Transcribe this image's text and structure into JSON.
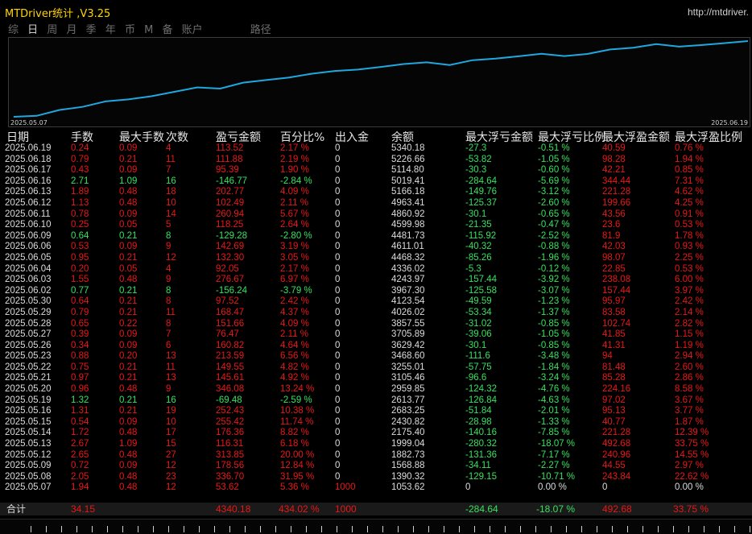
{
  "title": "MTDriver统计 ,V3.25",
  "url": "http://mtdriver.",
  "tabs": [
    "综",
    "日",
    "周",
    "月",
    "季",
    "年",
    "币",
    "M",
    "备",
    "账户"
  ],
  "tab_path": "路径",
  "active_tab": "日",
  "chart": {
    "x_start_label": "2025.05.07",
    "x_end_label": "2025.06.19",
    "line_color": "#1fa8e0"
  },
  "headers": [
    "日期",
    "手数",
    "最大手数",
    "次数",
    "盈亏金额",
    "百分比%",
    "出入金",
    "余额",
    "最大浮亏金额",
    "最大浮亏比例",
    "最大浮盈金额",
    "最大浮盈比例"
  ],
  "rows": [
    {
      "date": "2025.06.19",
      "lots": "0.24",
      "maxlots": "0.09",
      "count": "4",
      "pl": "113.52",
      "pct": "2.17 %",
      "io": "0",
      "bal": "5340.18",
      "mfl": "-27.3",
      "mflp": "-0.51 %",
      "mfp": "40.59",
      "mfpp": "0.76 %"
    },
    {
      "date": "2025.06.18",
      "lots": "0.79",
      "maxlots": "0.21",
      "count": "11",
      "pl": "111.88",
      "pct": "2.19 %",
      "io": "0",
      "bal": "5226.66",
      "mfl": "-53.82",
      "mflp": "-1.05 %",
      "mfp": "98.28",
      "mfpp": "1.94 %"
    },
    {
      "date": "2025.06.17",
      "lots": "0.43",
      "maxlots": "0.09",
      "count": "7",
      "pl": "95.39",
      "pct": "1.90 %",
      "io": "0",
      "bal": "5114.80",
      "mfl": "-30.3",
      "mflp": "-0.60 %",
      "mfp": "42.21",
      "mfpp": "0.85 %"
    },
    {
      "date": "2025.06.16",
      "lots": "2.71",
      "maxlots": "1.09",
      "count": "16",
      "pl": "-146.77",
      "pct": "-2.84 %",
      "io": "0",
      "bal": "5019.41",
      "mfl": "-284.64",
      "mflp": "-5.69 %",
      "mfp": "344.44",
      "mfpp": "7.31 %"
    },
    {
      "date": "2025.06.13",
      "lots": "1.89",
      "maxlots": "0.48",
      "count": "18",
      "pl": "202.77",
      "pct": "4.09 %",
      "io": "0",
      "bal": "5166.18",
      "mfl": "-149.76",
      "mflp": "-3.12 %",
      "mfp": "221.28",
      "mfpp": "4.62 %"
    },
    {
      "date": "2025.06.12",
      "lots": "1.13",
      "maxlots": "0.48",
      "count": "10",
      "pl": "102.49",
      "pct": "2.11 %",
      "io": "0",
      "bal": "4963.41",
      "mfl": "-125.37",
      "mflp": "-2.60 %",
      "mfp": "199.66",
      "mfpp": "4.25 %"
    },
    {
      "date": "2025.06.11",
      "lots": "0.78",
      "maxlots": "0.09",
      "count": "14",
      "pl": "260.94",
      "pct": "5.67 %",
      "io": "0",
      "bal": "4860.92",
      "mfl": "-30.1",
      "mflp": "-0.65 %",
      "mfp": "43.56",
      "mfpp": "0.91 %"
    },
    {
      "date": "2025.06.10",
      "lots": "0.25",
      "maxlots": "0.05",
      "count": "5",
      "pl": "118.25",
      "pct": "2.64 %",
      "io": "0",
      "bal": "4599.98",
      "mfl": "-21.35",
      "mflp": "-0.47 %",
      "mfp": "23.6",
      "mfpp": "0.53 %"
    },
    {
      "date": "2025.06.09",
      "lots": "0.64",
      "maxlots": "0.21",
      "count": "8",
      "pl": "-129.28",
      "pct": "-2.80 %",
      "io": "0",
      "bal": "4481.73",
      "mfl": "-115.92",
      "mflp": "-2.52 %",
      "mfp": "81.9",
      "mfpp": "1.78 %"
    },
    {
      "date": "2025.06.06",
      "lots": "0.53",
      "maxlots": "0.09",
      "count": "9",
      "pl": "142.69",
      "pct": "3.19 %",
      "io": "0",
      "bal": "4611.01",
      "mfl": "-40.32",
      "mflp": "-0.88 %",
      "mfp": "42.03",
      "mfpp": "0.93 %"
    },
    {
      "date": "2025.06.05",
      "lots": "0.95",
      "maxlots": "0.21",
      "count": "12",
      "pl": "132.30",
      "pct": "3.05 %",
      "io": "0",
      "bal": "4468.32",
      "mfl": "-85.26",
      "mflp": "-1.96 %",
      "mfp": "98.07",
      "mfpp": "2.25 %"
    },
    {
      "date": "2025.06.04",
      "lots": "0.20",
      "maxlots": "0.05",
      "count": "4",
      "pl": "92.05",
      "pct": "2.17 %",
      "io": "0",
      "bal": "4336.02",
      "mfl": "-5.3",
      "mflp": "-0.12 %",
      "mfp": "22.85",
      "mfpp": "0.53 %"
    },
    {
      "date": "2025.06.03",
      "lots": "1.55",
      "maxlots": "0.48",
      "count": "9",
      "pl": "276.67",
      "pct": "6.97 %",
      "io": "0",
      "bal": "4243.97",
      "mfl": "-157.44",
      "mflp": "-3.92 %",
      "mfp": "238.08",
      "mfpp": "6.00 %"
    },
    {
      "date": "2025.06.02",
      "lots": "0.77",
      "maxlots": "0.21",
      "count": "8",
      "pl": "-156.24",
      "pct": "-3.79 %",
      "io": "0",
      "bal": "3967.30",
      "mfl": "-125.58",
      "mflp": "-3.07 %",
      "mfp": "157.44",
      "mfpp": "3.97 %"
    },
    {
      "date": "2025.05.30",
      "lots": "0.64",
      "maxlots": "0.21",
      "count": "8",
      "pl": "97.52",
      "pct": "2.42 %",
      "io": "0",
      "bal": "4123.54",
      "mfl": "-49.59",
      "mflp": "-1.23 %",
      "mfp": "95.97",
      "mfpp": "2.42 %"
    },
    {
      "date": "2025.05.29",
      "lots": "0.79",
      "maxlots": "0.21",
      "count": "11",
      "pl": "168.47",
      "pct": "4.37 %",
      "io": "0",
      "bal": "4026.02",
      "mfl": "-53.34",
      "mflp": "-1.37 %",
      "mfp": "83.58",
      "mfpp": "2.14 %"
    },
    {
      "date": "2025.05.28",
      "lots": "0.65",
      "maxlots": "0.22",
      "count": "8",
      "pl": "151.66",
      "pct": "4.09 %",
      "io": "0",
      "bal": "3857.55",
      "mfl": "-31.02",
      "mflp": "-0.85 %",
      "mfp": "102.74",
      "mfpp": "2.82 %"
    },
    {
      "date": "2025.05.27",
      "lots": "0.39",
      "maxlots": "0.09",
      "count": "7",
      "pl": "76.47",
      "pct": "2.11 %",
      "io": "0",
      "bal": "3705.89",
      "mfl": "-39.06",
      "mflp": "-1.05 %",
      "mfp": "41.85",
      "mfpp": "1.15 %"
    },
    {
      "date": "2025.05.26",
      "lots": "0.34",
      "maxlots": "0.09",
      "count": "6",
      "pl": "160.82",
      "pct": "4.64 %",
      "io": "0",
      "bal": "3629.42",
      "mfl": "-30.1",
      "mflp": "-0.85 %",
      "mfp": "41.31",
      "mfpp": "1.19 %"
    },
    {
      "date": "2025.05.23",
      "lots": "0.88",
      "maxlots": "0.20",
      "count": "13",
      "pl": "213.59",
      "pct": "6.56 %",
      "io": "0",
      "bal": "3468.60",
      "mfl": "-111.6",
      "mflp": "-3.48 %",
      "mfp": "94",
      "mfpp": "2.94 %"
    },
    {
      "date": "2025.05.22",
      "lots": "0.75",
      "maxlots": "0.21",
      "count": "11",
      "pl": "149.55",
      "pct": "4.82 %",
      "io": "0",
      "bal": "3255.01",
      "mfl": "-57.75",
      "mflp": "-1.84 %",
      "mfp": "81.48",
      "mfpp": "2.60 %"
    },
    {
      "date": "2025.05.21",
      "lots": "0.97",
      "maxlots": "0.21",
      "count": "13",
      "pl": "145.61",
      "pct": "4.92 %",
      "io": "0",
      "bal": "3105.46",
      "mfl": "-96.6",
      "mflp": "-3.24 %",
      "mfp": "85.28",
      "mfpp": "2.86 %"
    },
    {
      "date": "2025.05.20",
      "lots": "0.96",
      "maxlots": "0.48",
      "count": "9",
      "pl": "346.08",
      "pct": "13.24 %",
      "io": "0",
      "bal": "2959.85",
      "mfl": "-124.32",
      "mflp": "-4.76 %",
      "mfp": "224.16",
      "mfpp": "8.58 %"
    },
    {
      "date": "2025.05.19",
      "lots": "1.32",
      "maxlots": "0.21",
      "count": "16",
      "pl": "-69.48",
      "pct": "-2.59 %",
      "io": "0",
      "bal": "2613.77",
      "mfl": "-126.84",
      "mflp": "-4.63 %",
      "mfp": "97.02",
      "mfpp": "3.67 %"
    },
    {
      "date": "2025.05.16",
      "lots": "1.31",
      "maxlots": "0.21",
      "count": "19",
      "pl": "252.43",
      "pct": "10.38 %",
      "io": "0",
      "bal": "2683.25",
      "mfl": "-51.84",
      "mflp": "-2.01 %",
      "mfp": "95.13",
      "mfpp": "3.77 %"
    },
    {
      "date": "2025.05.15",
      "lots": "0.54",
      "maxlots": "0.09",
      "count": "10",
      "pl": "255.42",
      "pct": "11.74 %",
      "io": "0",
      "bal": "2430.82",
      "mfl": "-28.98",
      "mflp": "-1.33 %",
      "mfp": "40.77",
      "mfpp": "1.87 %"
    },
    {
      "date": "2025.05.14",
      "lots": "1.72",
      "maxlots": "0.48",
      "count": "17",
      "pl": "176.36",
      "pct": "8.82 %",
      "io": "0",
      "bal": "2175.40",
      "mfl": "-140.16",
      "mflp": "-7.85 %",
      "mfp": "221.28",
      "mfpp": "12.39 %"
    },
    {
      "date": "2025.05.13",
      "lots": "2.67",
      "maxlots": "1.09",
      "count": "15",
      "pl": "116.31",
      "pct": "6.18 %",
      "io": "0",
      "bal": "1999.04",
      "mfl": "-280.32",
      "mflp": "-18.07 %",
      "mfp": "492.68",
      "mfpp": "33.75 %"
    },
    {
      "date": "2025.05.12",
      "lots": "2.65",
      "maxlots": "0.48",
      "count": "27",
      "pl": "313.85",
      "pct": "20.00 %",
      "io": "0",
      "bal": "1882.73",
      "mfl": "-131.36",
      "mflp": "-7.17 %",
      "mfp": "240.96",
      "mfpp": "14.55 %"
    },
    {
      "date": "2025.05.09",
      "lots": "0.72",
      "maxlots": "0.09",
      "count": "12",
      "pl": "178.56",
      "pct": "12.84 %",
      "io": "0",
      "bal": "1568.88",
      "mfl": "-34.11",
      "mflp": "-2.27 %",
      "mfp": "44.55",
      "mfpp": "2.97 %"
    },
    {
      "date": "2025.05.08",
      "lots": "2.05",
      "maxlots": "0.48",
      "count": "23",
      "pl": "336.70",
      "pct": "31.95 %",
      "io": "0",
      "bal": "1390.32",
      "mfl": "-129.15",
      "mflp": "-10.71 %",
      "mfp": "243.84",
      "mfpp": "22.62 %"
    },
    {
      "date": "2025.05.07",
      "lots": "1.94",
      "maxlots": "0.48",
      "count": "12",
      "pl": "53.62",
      "pct": "5.36 %",
      "io": "1000",
      "bal": "1053.62",
      "mfl": "0",
      "mflp": "0.00 %",
      "mfp": "0",
      "mfpp": "0.00 %"
    }
  ],
  "total": {
    "label": "合计",
    "lots": "34.15",
    "pl": "4340.18",
    "pct": "434.02 %",
    "io": "1000",
    "mfl": "-284.64",
    "mflp": "-18.07 %",
    "mfp": "492.68",
    "mfpp": "33.75 %"
  }
}
